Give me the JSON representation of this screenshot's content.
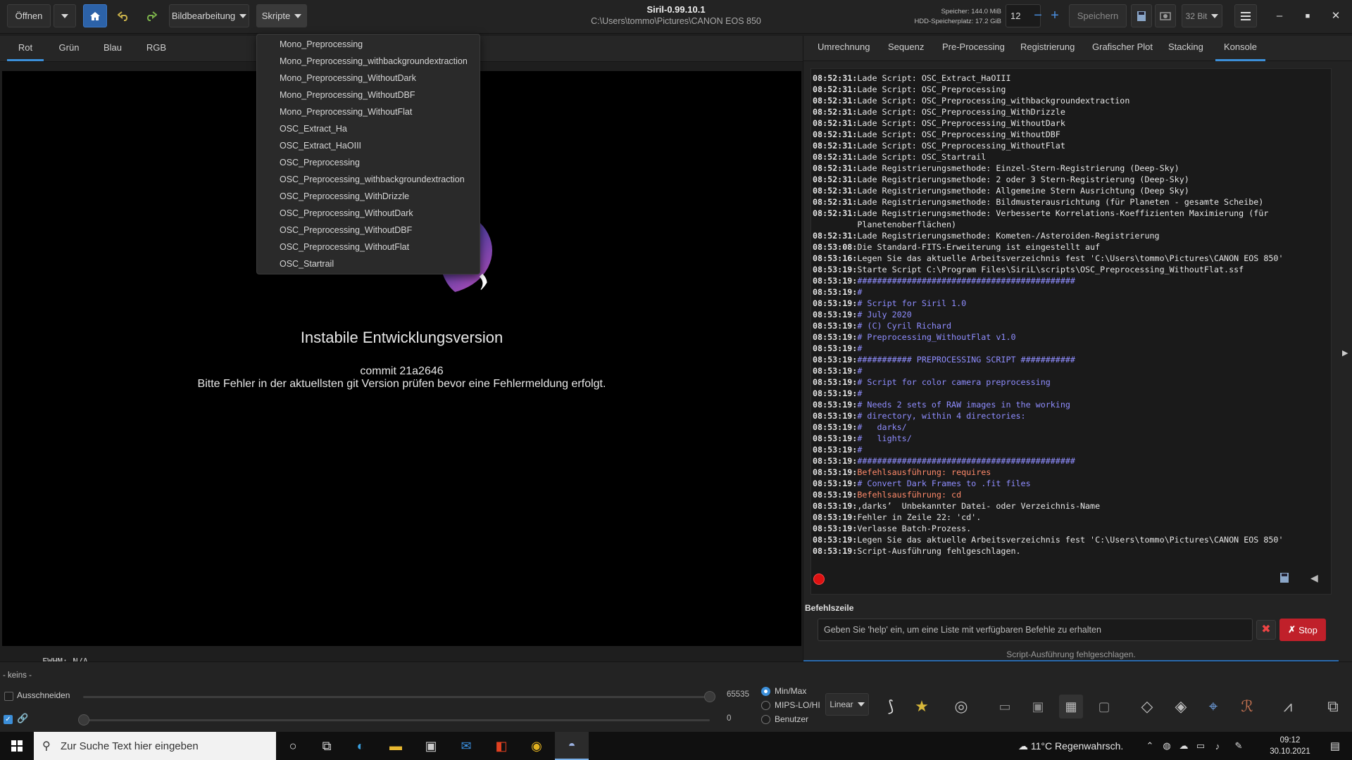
{
  "header": {
    "open_label": "Öffnen",
    "edit_label": "Bildbearbeitung",
    "scripts_label": "Skripte",
    "title": "Siril-0.99.10.1",
    "path": "C:\\Users\\tommo\\Pictures\\CANON EOS 850",
    "memory": "Speicher: 144.0 MiB",
    "disk": "HDD-Speicherplatz: 17.2 GiB",
    "thread_count": "12",
    "save_label": "Speichern",
    "bit_depth": "32 Bit"
  },
  "channel_tabs": [
    "Rot",
    "Grün",
    "Blau",
    "RGB"
  ],
  "scripts_menu": [
    "Mono_Preprocessing",
    "Mono_Preprocessing_withbackgroundextraction",
    "Mono_Preprocessing_WithoutDark",
    "Mono_Preprocessing_WithoutDBF",
    "Mono_Preprocessing_WithoutFlat",
    "OSC_Extract_Ha",
    "OSC_Extract_HaOIII",
    "OSC_Preprocessing",
    "OSC_Preprocessing_withbackgroundextraction",
    "OSC_Preprocessing_WithDrizzle",
    "OSC_Preprocessing_WithoutDark",
    "OSC_Preprocessing_WithoutDBF",
    "OSC_Preprocessing_WithoutFlat",
    "OSC_Startrail"
  ],
  "image_area": {
    "welcome_title": "Instabile Entwicklungsversion",
    "commit_line": "commit 21a2646",
    "bugs_line": "Bitte Fehler in der aktuellsten git Version prüfen bevor eine Fehlermeldung erfolgt.",
    "fwhm": "FWHM: N/A"
  },
  "right_tabs": [
    "Umrechnung",
    "Sequenz",
    "Pre-Processing",
    "Registrierung",
    "Grafischer Plot",
    "Stacking",
    "Konsole"
  ],
  "console_lines": [
    {
      "ts": "08:52:31:",
      "msg": "Lade Script: OSC_Extract_HaOIII",
      "color": "#e6e6e6"
    },
    {
      "ts": "08:52:31:",
      "msg": "Lade Script: OSC_Preprocessing",
      "color": "#e6e6e6"
    },
    {
      "ts": "08:52:31:",
      "msg": "Lade Script: OSC_Preprocessing_withbackgroundextraction",
      "color": "#e6e6e6"
    },
    {
      "ts": "08:52:31:",
      "msg": "Lade Script: OSC_Preprocessing_WithDrizzle",
      "color": "#e6e6e6"
    },
    {
      "ts": "08:52:31:",
      "msg": "Lade Script: OSC_Preprocessing_WithoutDark",
      "color": "#e6e6e6"
    },
    {
      "ts": "08:52:31:",
      "msg": "Lade Script: OSC_Preprocessing_WithoutDBF",
      "color": "#e6e6e6"
    },
    {
      "ts": "08:52:31:",
      "msg": "Lade Script: OSC_Preprocessing_WithoutFlat",
      "color": "#e6e6e6"
    },
    {
      "ts": "08:52:31:",
      "msg": "Lade Script: OSC_Startrail",
      "color": "#e6e6e6"
    },
    {
      "ts": "08:52:31:",
      "msg": "Lade Registrierungsmethode: Einzel-Stern-Registrierung (Deep-Sky)",
      "color": "#e6e6e6"
    },
    {
      "ts": "08:52:31:",
      "msg": "Lade Registrierungsmethode: 2 oder 3 Stern-Registrierung (Deep-Sky)",
      "color": "#e6e6e6"
    },
    {
      "ts": "08:52:31:",
      "msg": "Lade Registrierungsmethode: Allgemeine Stern Ausrichtung (Deep Sky)",
      "color": "#e6e6e6"
    },
    {
      "ts": "08:52:31:",
      "msg": "Lade Registrierungsmethode: Bildmusterausrichtung (für Planeten - gesamte Scheibe)",
      "color": "#e6e6e6"
    },
    {
      "ts": "08:52:31:",
      "msg": "Lade Registrierungsmethode: Verbesserte Korrelations-Koeffizienten Maximierung (für Planetenoberflächen)",
      "color": "#e6e6e6"
    },
    {
      "ts": "08:52:31:",
      "msg": "Lade Registrierungsmethode: Kometen-/Asteroiden-Registrierung",
      "color": "#e6e6e6"
    },
    {
      "ts": "08:53:08:",
      "msg": "Die Standard-FITS-Erweiterung ist eingestellt auf",
      "color": "#e6e6e6"
    },
    {
      "ts": "08:53:16:",
      "msg": "Legen Sie das aktuelle Arbeitsverzeichnis fest 'C:\\Users\\tommo\\Pictures\\CANON EOS 850'",
      "color": "#e6e6e6"
    },
    {
      "ts": "08:53:19:",
      "msg": "Starte Script C:\\Program Files\\SiriL\\scripts\\OSC_Preprocessing_WithoutFlat.ssf",
      "color": "#e6e6e6"
    },
    {
      "ts": "08:53:19:",
      "msg": "############################################",
      "color": "#8f8dff"
    },
    {
      "ts": "08:53:19:",
      "msg": "#",
      "color": "#8f8dff"
    },
    {
      "ts": "08:53:19:",
      "msg": "# Script for Siril 1.0",
      "color": "#8f8dff"
    },
    {
      "ts": "08:53:19:",
      "msg": "# July 2020",
      "color": "#8f8dff"
    },
    {
      "ts": "08:53:19:",
      "msg": "# (C) Cyril Richard",
      "color": "#8f8dff"
    },
    {
      "ts": "08:53:19:",
      "msg": "# Preprocessing_WithoutFlat v1.0",
      "color": "#8f8dff"
    },
    {
      "ts": "08:53:19:",
      "msg": "#",
      "color": "#8f8dff"
    },
    {
      "ts": "08:53:19:",
      "msg": "########### PREPROCESSING SCRIPT ###########",
      "color": "#8f8dff"
    },
    {
      "ts": "08:53:19:",
      "msg": "#",
      "color": "#8f8dff"
    },
    {
      "ts": "08:53:19:",
      "msg": "# Script for color camera preprocessing",
      "color": "#8f8dff"
    },
    {
      "ts": "08:53:19:",
      "msg": "#",
      "color": "#8f8dff"
    },
    {
      "ts": "08:53:19:",
      "msg": "# Needs 2 sets of RAW images in the working",
      "color": "#8f8dff"
    },
    {
      "ts": "08:53:19:",
      "msg": "# directory, within 4 directories:",
      "color": "#8f8dff"
    },
    {
      "ts": "08:53:19:",
      "msg": "#   darks/",
      "color": "#8f8dff"
    },
    {
      "ts": "08:53:19:",
      "msg": "#   lights/",
      "color": "#8f8dff"
    },
    {
      "ts": "08:53:19:",
      "msg": "#",
      "color": "#8f8dff"
    },
    {
      "ts": "08:53:19:",
      "msg": "############################################",
      "color": "#8f8dff"
    },
    {
      "ts": "08:53:19:",
      "msg": "Befehlsausführung: requires",
      "color": "#ff8a6a"
    },
    {
      "ts": "08:53:19:",
      "msg": "# Convert Dark Frames to .fit files",
      "color": "#8f8dff"
    },
    {
      "ts": "08:53:19:",
      "msg": "Befehlsausführung: cd",
      "color": "#ff8a6a"
    },
    {
      "ts": "08:53:19:",
      "msg": "‚darks’  Unbekannter Datei- oder Verzeichnis-Name",
      "color": "#e6e6e6"
    },
    {
      "ts": "08:53:19:",
      "msg": "Fehler in Zeile 22: 'cd'.",
      "color": "#e6e6e6"
    },
    {
      "ts": "08:53:19:",
      "msg": "Verlasse Batch-Prozess.",
      "color": "#e6e6e6"
    },
    {
      "ts": "08:53:19:",
      "msg": "Legen Sie das aktuelle Arbeitsverzeichnis fest 'C:\\Users\\tommo\\Pictures\\CANON EOS 850'",
      "color": "#e6e6e6"
    },
    {
      "ts": "08:53:19:",
      "msg": "Script-Ausführung fehlgeschlagen.",
      "color": "#e6e6e6"
    }
  ],
  "command": {
    "label": "Befehlszeile",
    "placeholder": "Geben Sie 'help' ein, um eine Liste mit verfügbaren Befehle zu erhalten",
    "stop_label": "Stop",
    "status": "Script-Ausführung fehlgeschlagen."
  },
  "bottom": {
    "keins": "- keins -",
    "crop_label": "Ausschneiden",
    "hi_value": "65535",
    "lo_value": "0",
    "modes": [
      "Min/Max",
      "MIPS-LO/HI",
      "Benutzer"
    ],
    "selected_mode": "Min/Max",
    "stretch": "Linear"
  },
  "taskbar": {
    "search_placeholder": "Zur Suche Text hier eingeben",
    "weather": "11°C  Regenwahrsch.",
    "time": "09:12",
    "date": "30.10.2021"
  },
  "colors": {
    "accent": "#3c8fd9",
    "stop": "#c0202a",
    "comment": "#8f8dff",
    "command": "#ff8a6a"
  }
}
